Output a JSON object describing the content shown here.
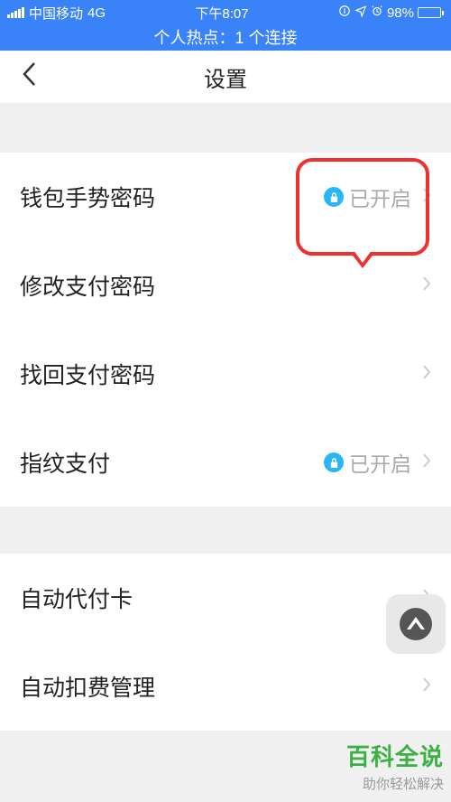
{
  "statusBar": {
    "carrier": "中国移动",
    "network": "4G",
    "time": "下午8:07",
    "battery": "98%"
  },
  "hotspot": "个人热点：1 个连接",
  "nav": {
    "title": "设置"
  },
  "items": {
    "gesture": {
      "label": "钱包手势密码",
      "status": "已开启"
    },
    "modifyPwd": {
      "label": "修改支付密码"
    },
    "recoverPwd": {
      "label": "找回支付密码"
    },
    "fingerprint": {
      "label": "指纹支付",
      "status": "已开启"
    },
    "autoPayCard": {
      "label": "自动代付卡"
    },
    "autoDeduct": {
      "label": "自动扣费管理"
    }
  },
  "watermark": {
    "title": "百科全说",
    "sub": "助你轻松解决"
  }
}
